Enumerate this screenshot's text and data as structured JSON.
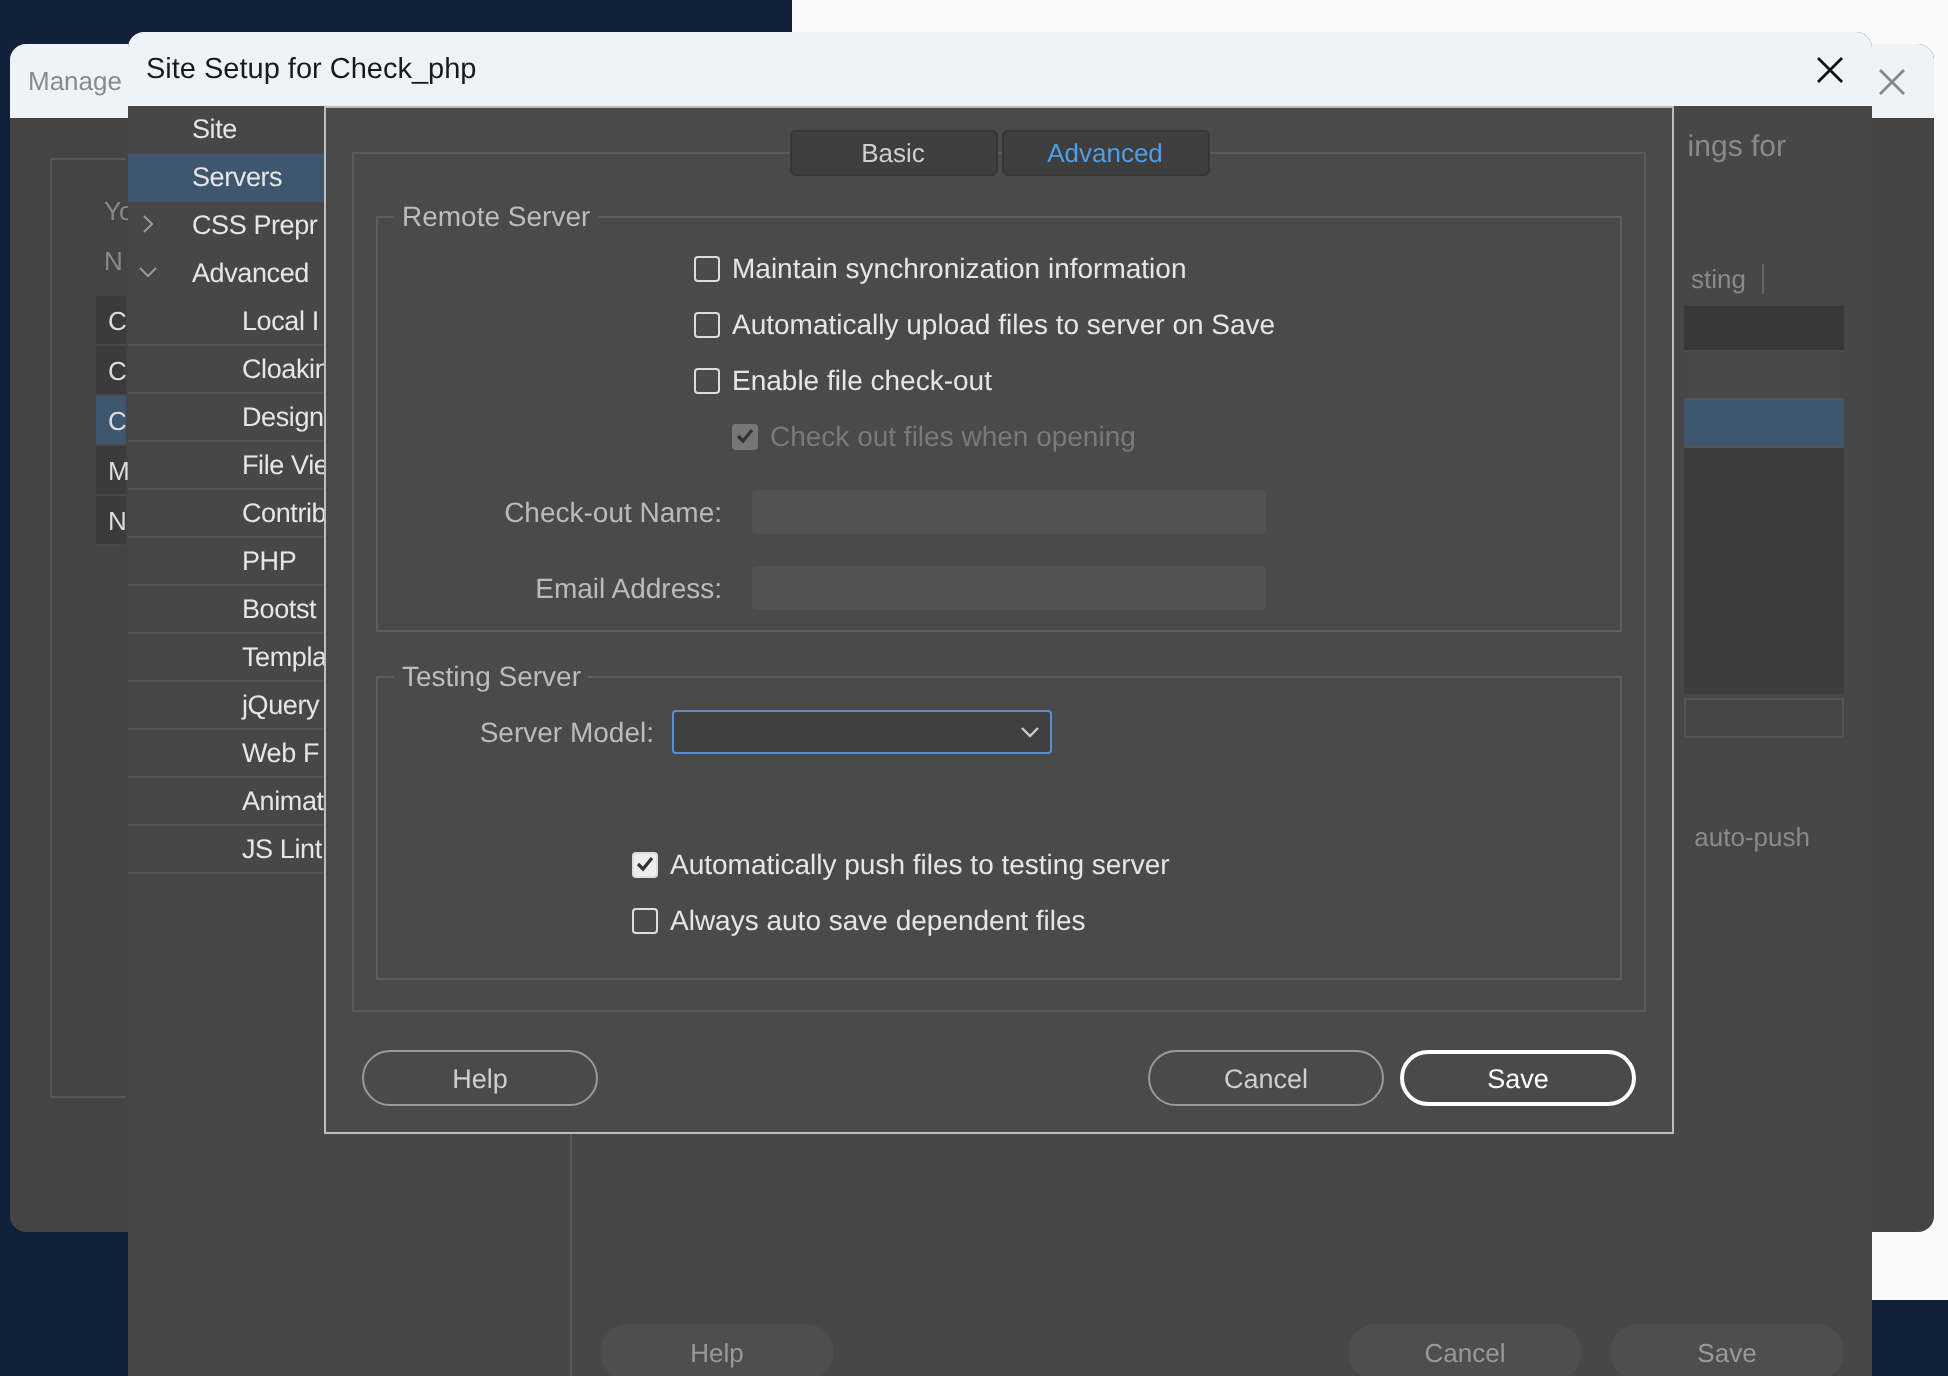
{
  "manage_window": {
    "title": "Manage",
    "list_hint": "Yo",
    "list_header": "N",
    "rows": [
      {
        "label": "C",
        "selected": false
      },
      {
        "label": "C",
        "selected": false
      },
      {
        "label": "C",
        "selected": true
      },
      {
        "label": "M",
        "selected": false
      },
      {
        "label": "N",
        "selected": false
      }
    ]
  },
  "site_setup": {
    "title": "Site Setup for Check_php",
    "sidebar": [
      {
        "label": "Site",
        "selected": false
      },
      {
        "label": "Servers",
        "selected": true
      },
      {
        "label": "CSS Prepr",
        "selected": false,
        "expanded": false
      },
      {
        "label": "Advanced",
        "selected": false,
        "expanded": true,
        "children": [
          {
            "label": "Local I",
            "selected": false
          },
          {
            "label": "Cloakin",
            "selected": false
          },
          {
            "label": "Design",
            "selected": false
          },
          {
            "label": "File Vie",
            "selected": false
          },
          {
            "label": "Contrib",
            "selected": false
          },
          {
            "label": "PHP",
            "selected": false
          },
          {
            "label": "Bootst",
            "selected": false
          },
          {
            "label": "Templa",
            "selected": false
          },
          {
            "label": "jQuery",
            "selected": false
          },
          {
            "label": "Web F",
            "selected": false
          },
          {
            "label": "Animat",
            "selected": false
          },
          {
            "label": "JS Lint",
            "selected": false
          }
        ]
      }
    ],
    "intro": "ings for",
    "table": {
      "columns": [
        "sting"
      ],
      "rows": [
        {
          "selected": false
        },
        {
          "selected": true
        }
      ]
    },
    "note": "auto-push",
    "buttons": [
      {
        "label": "Help"
      },
      {
        "label": "Cancel"
      },
      {
        "label": "Save"
      }
    ]
  },
  "dialog": {
    "tabs": [
      {
        "label": "Basic",
        "selected": false
      },
      {
        "label": "Advanced",
        "selected": true
      }
    ],
    "remote_server": {
      "title": "Remote Server",
      "options": [
        {
          "label": "Maintain synchronization information",
          "checked": false,
          "disabled": false
        },
        {
          "label": "Automatically upload files to server on Save",
          "checked": false,
          "disabled": false
        },
        {
          "label": "Enable file check-out",
          "checked": false,
          "disabled": false,
          "children": [
            {
              "label": "Check out files when opening",
              "checked": true,
              "disabled": true
            }
          ]
        }
      ],
      "fields": [
        {
          "label": "Check-out Name:",
          "disabled": true
        },
        {
          "label": "Email Address:",
          "disabled": true
        }
      ]
    },
    "testing_server": {
      "title": "Testing Server",
      "server_model": {
        "label": "Server Model:",
        "focused": true
      },
      "options": [
        {
          "label": "Automatically push files to testing server",
          "checked": true,
          "disabled": false
        },
        {
          "label": "Always auto save dependent files",
          "checked": false,
          "disabled": false
        }
      ]
    },
    "buttons": [
      {
        "label": "Help",
        "kind": "secondary"
      },
      {
        "label": "Cancel",
        "kind": "secondary"
      },
      {
        "label": "Save",
        "kind": "primary"
      }
    ]
  }
}
